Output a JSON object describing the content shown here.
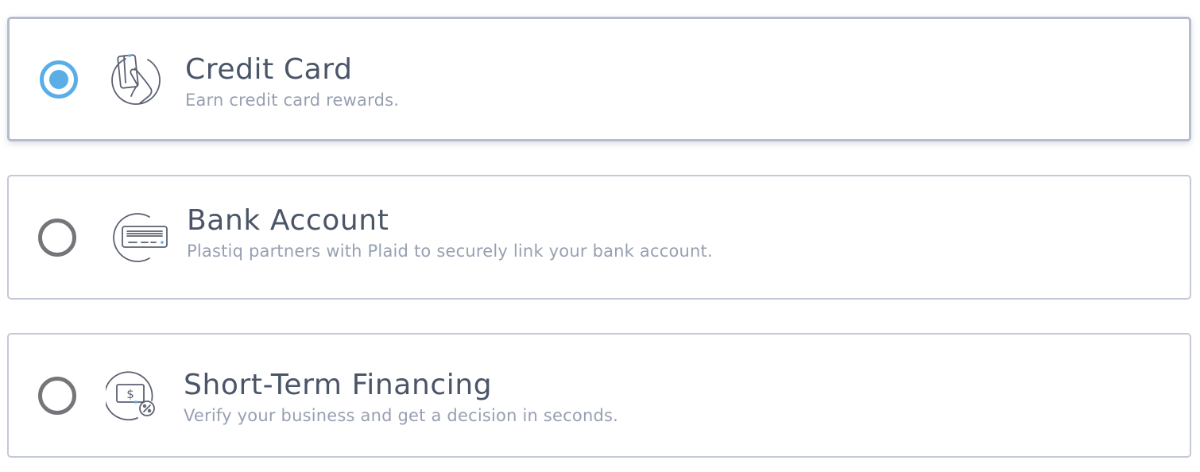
{
  "payment_methods": [
    {
      "title": "Credit Card",
      "subtitle": "Earn credit card rewards.",
      "icon": "credit-card-hand-icon",
      "selected": true
    },
    {
      "title": "Bank Account",
      "subtitle": "Plastiq partners with Plaid to securely link your bank account.",
      "icon": "bank-check-icon",
      "selected": false
    },
    {
      "title": "Short-Term Financing",
      "subtitle": "Verify your business and get a decision in seconds.",
      "icon": "financing-dollar-percent-icon",
      "selected": false
    }
  ],
  "colors": {
    "accent": "#5aaee6",
    "title_text": "#4a5568",
    "subtitle_text": "#97a0b2",
    "radio_unchecked": "#76767a",
    "card_border": "#c3c9d6"
  }
}
